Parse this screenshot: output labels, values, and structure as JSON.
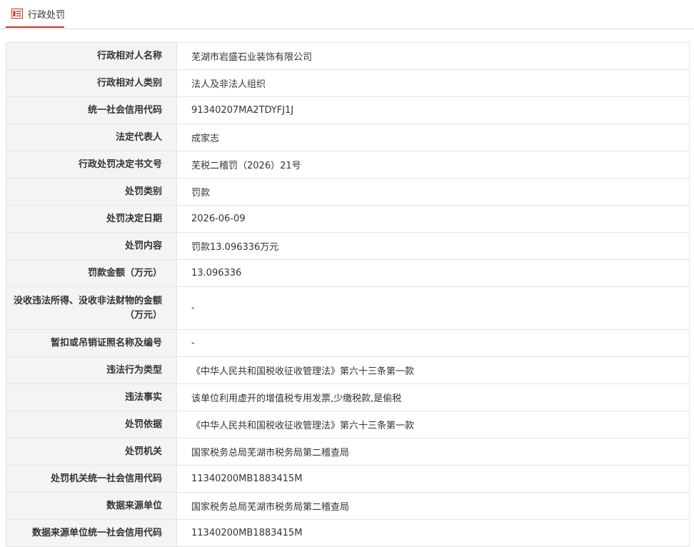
{
  "header": {
    "tab_label": "行政处罚",
    "icon": "document-list-icon",
    "accent_color": "#c9302c"
  },
  "rows": [
    {
      "label": "行政相对人名称",
      "value": "芜湖市岩盛石业装饰有限公司"
    },
    {
      "label": "行政相对人类别",
      "value": "法人及非法人组织"
    },
    {
      "label": "统一社会信用代码",
      "value": "91340207MA2TDYFJ1J"
    },
    {
      "label": "法定代表人",
      "value": "成家志"
    },
    {
      "label": "行政处罚决定书文号",
      "value": "芜税二稽罚（2026）21号"
    },
    {
      "label": "处罚类别",
      "value": "罚款"
    },
    {
      "label": "处罚决定日期",
      "value": "2026-06-09"
    },
    {
      "label": "处罚内容",
      "value": "罚款13.096336万元"
    },
    {
      "label": "罚款金额（万元）",
      "value": "13.096336"
    },
    {
      "label": "没收违法所得、没收非法财物的金额（万元）",
      "value": "-"
    },
    {
      "label": "暂扣或吊销证照名称及编号",
      "value": "-"
    },
    {
      "label": "违法行为类型",
      "value": "《中华人民共和国税收征收管理法》第六十三条第一款"
    },
    {
      "label": "违法事实",
      "value": "该单位利用虚开的增值税专用发票,少缴税款,是偷税"
    },
    {
      "label": "处罚依据",
      "value": "《中华人民共和国税收征收管理法》第六十三条第一款"
    },
    {
      "label": "处罚机关",
      "value": "国家税务总局芜湖市税务局第二稽查局"
    },
    {
      "label": "处罚机关统一社会信用代码",
      "value": "11340200MB1883415M"
    },
    {
      "label": "数据来源单位",
      "value": "国家税务总局芜湖市税务局第二稽查局"
    },
    {
      "label": "数据来源单位统一社会信用代码",
      "value": "11340200MB1883415M"
    }
  ]
}
